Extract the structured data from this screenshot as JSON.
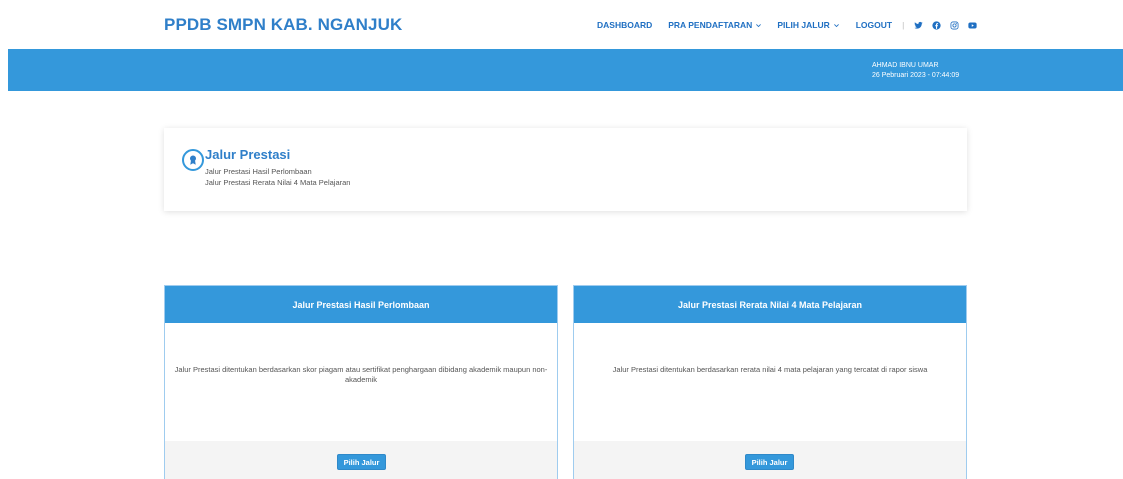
{
  "header": {
    "brand": "PPDB SMPN KAB. NGANJUK",
    "menu": {
      "dashboard": "DASHBOARD",
      "pra_pendaftaran": "PRA PENDAFTARAN",
      "pilih_jalur": "PILIH JALUR",
      "logout": "LOGOUT",
      "separator": "|"
    },
    "social_icons": [
      "twitter-icon",
      "facebook-icon",
      "instagram-icon",
      "youtube-icon"
    ]
  },
  "userbar": {
    "name": "AHMAD IBNU UMAR",
    "datetime": "26 Pebruari 2023 - 07:44:09"
  },
  "info": {
    "title": "Jalur Prestasi",
    "lines": [
      "Jalur Prestasi Hasil Perlombaan",
      "Jalur Prestasi Rerata Nilai 4 Mata Pelajaran"
    ]
  },
  "cards": [
    {
      "title": "Jalur Prestasi Hasil Perlombaan",
      "description": "Jalur Prestasi ditentukan berdasarkan skor piagam atau sertifikat penghargaan dibidang akademik maupun non-akademik",
      "button": "Pilih Jalur"
    },
    {
      "title": "Jalur Prestasi Rerata Nilai 4 Mata Pelajaran",
      "description": "Jalur Prestasi ditentukan berdasarkan rerata nilai 4 mata pelajaran yang tercatat di rapor siswa",
      "button": "Pilih Jalur"
    }
  ],
  "colors": {
    "primary": "#3498db",
    "brand_text": "#2f7fc9",
    "footer_bg": "#f4f4f4"
  }
}
